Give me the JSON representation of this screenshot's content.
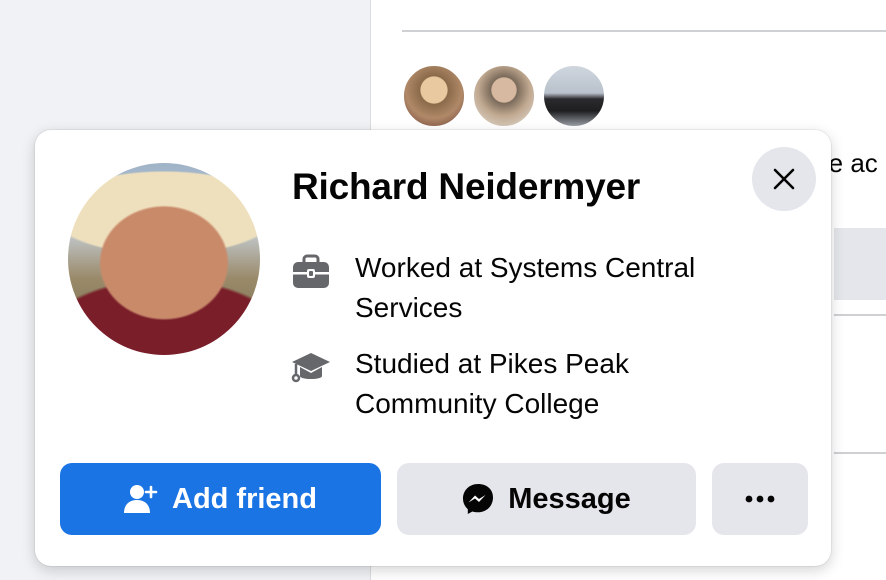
{
  "background": {
    "partial_text": "re ac"
  },
  "card": {
    "name": "Richard Neidermyer",
    "work": "Worked at Systems Central Services",
    "education": "Studied at Pikes Peak Community College",
    "buttons": {
      "add_friend": "Add friend",
      "message": "Message"
    },
    "icons": {
      "close": "close-icon",
      "work": "briefcase-icon",
      "education": "graduation-cap-icon",
      "add_friend": "add-person-icon",
      "message": "messenger-icon",
      "more": "more-dots-icon"
    },
    "colors": {
      "primary": "#1b74e4",
      "secondary_button": "#e4e6eb",
      "icon_gray": "#65676b",
      "text": "#050505"
    }
  }
}
